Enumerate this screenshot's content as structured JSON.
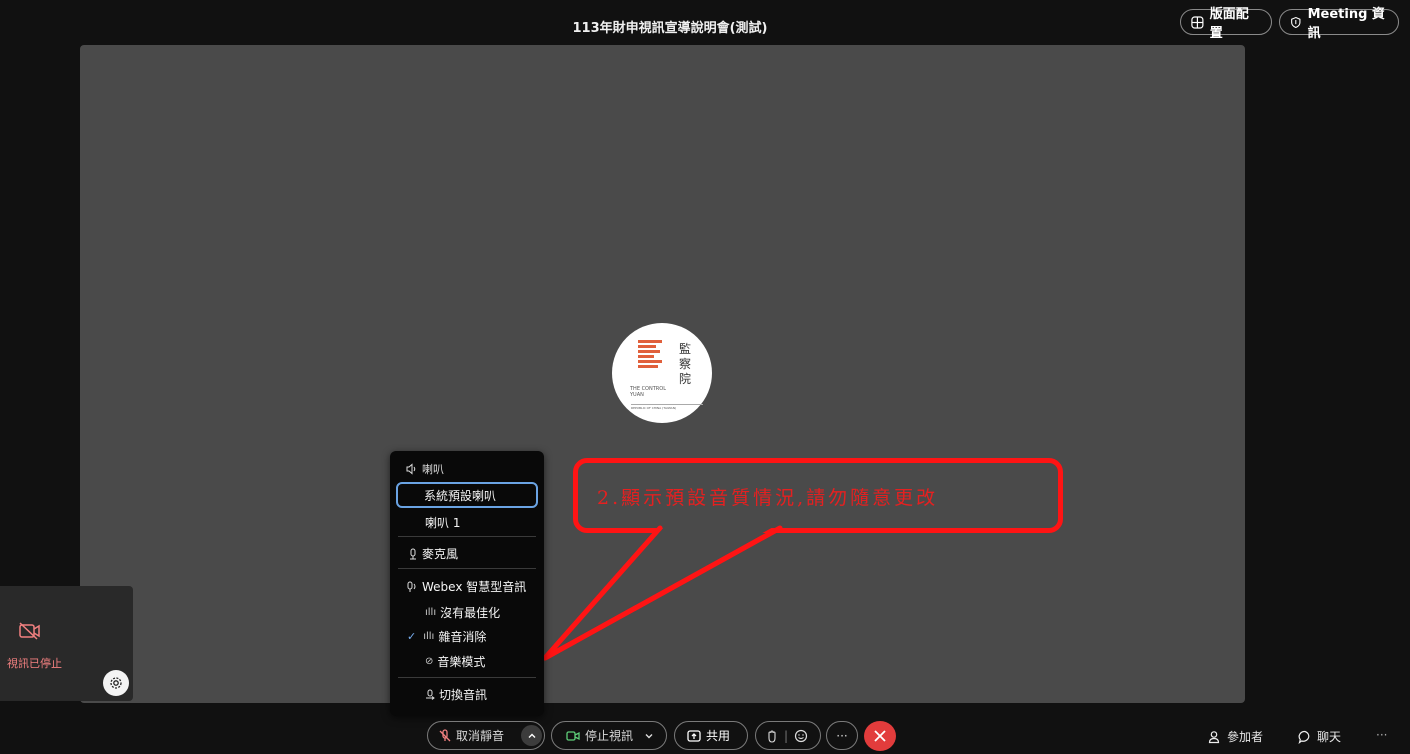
{
  "header": {
    "meeting_title": "113年財申視訊宣導說明會(測試)",
    "layout_button": "版面配置",
    "meeting_info_button": "Meeting 資訊"
  },
  "logo": {
    "cn_text": "監察院",
    "en_text": "THE CONTROL YUAN",
    "sub_text": "REPUBLIC OF CHINA (TAIWAN)"
  },
  "self_view": {
    "status_text": "視訊已停止"
  },
  "audio_menu": {
    "speaker_section": "喇叭",
    "speaker_options": [
      "系統預設喇叭",
      "喇叭 1"
    ],
    "microphone_section": "麥克風",
    "smart_audio_section": "Webex 智慧型音訊",
    "smart_audio_options": [
      "沒有最佳化",
      "雜音消除",
      "音樂模式"
    ],
    "switch_audio": "切換音訊"
  },
  "callout": {
    "text": "2.顯示預設音質情況,請勿隨意更改"
  },
  "controls": {
    "unmute": "取消靜音",
    "stop_video": "停止視訊",
    "share": "共用",
    "participants": "參加者",
    "chat": "聊天",
    "more_dots": "···"
  },
  "colors": {
    "stage": "#4a4a4a",
    "callout_red": "#ff1414",
    "end_call": "#e23c3c",
    "video_stopped": "#f28080",
    "focus_blue": "#6aa3e3"
  }
}
